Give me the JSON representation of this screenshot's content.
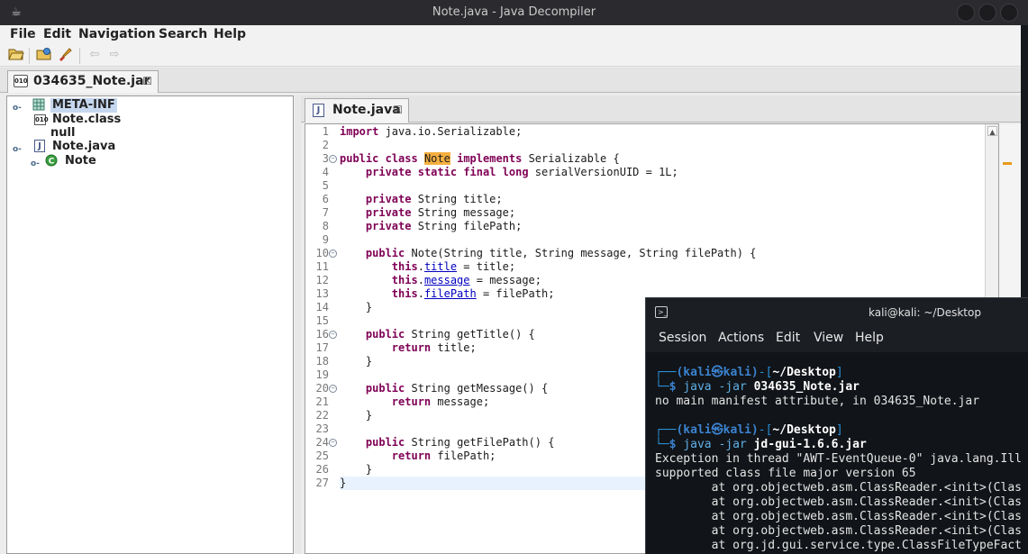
{
  "window": {
    "title": "Note.java - Java Decompiler",
    "app_icon": "coffee-cup-icon"
  },
  "menu": {
    "items": [
      "File",
      "Edit",
      "Navigation",
      "Search",
      "Help"
    ]
  },
  "toolbar": {
    "icons": [
      "open-folder-icon",
      "open-type-icon",
      "search-rocket-icon",
      "back-arrow-icon",
      "forward-arrow-icon"
    ]
  },
  "file_tab": {
    "label": "034635_Note.jar",
    "close": "☒"
  },
  "tree": {
    "items": [
      {
        "label": "META-INF",
        "icon": "package-icon"
      },
      {
        "label": "Note.class",
        "icon": "class-file-icon"
      },
      {
        "label": "null",
        "icon": ""
      },
      {
        "label": "Note.java",
        "icon": "java-file-icon"
      },
      {
        "label": "Note",
        "icon": "class-c-icon"
      }
    ]
  },
  "editor_tab": {
    "label": "Note.java",
    "close": "☒"
  },
  "code": {
    "line_numbers": [
      "1",
      "2",
      "3",
      "4",
      "5",
      "6",
      "7",
      "8",
      "9",
      "10",
      "11",
      "12",
      "13",
      "14",
      "15",
      "16",
      "17",
      "18",
      "19",
      "20",
      "21",
      "22",
      "23",
      "24",
      "25",
      "26",
      "27"
    ]
  },
  "terminal": {
    "title": "kali@kali: ~/Desktop",
    "menu": [
      "Session",
      "Actions",
      "Edit",
      "View",
      "Help"
    ],
    "prompt_user": "(kali㉿kali)",
    "prompt_dir": "~/Desktop",
    "cmd1_prefix": "java -jar",
    "cmd1_arg": "034635_Note.jar",
    "out1": "no main manifest attribute, in 034635_Note.jar",
    "cmd2_prefix": "java -jar",
    "cmd2_arg": "jd-gui-1.6.6.jar",
    "out2_line1": "Exception in thread \"AWT-EventQueue-0\" java.lang.Ill",
    "out2_line2": "supported class file major version 65",
    "trace": [
      "        at org.objectweb.asm.ClassReader.<init>(Clas",
      "        at org.objectweb.asm.ClassReader.<init>(Clas",
      "        at org.objectweb.asm.ClassReader.<init>(Clas",
      "        at org.objectweb.asm.ClassReader.<init>(Clas",
      "        at org.jd.gui.service.type.ClassFileTypeFact"
    ]
  },
  "colors": {
    "keyword": "#7f0055",
    "field": "#0000c0",
    "highlight": "#f5b041",
    "terminal_bg": "#111418",
    "prompt": "#2b8fd7"
  }
}
